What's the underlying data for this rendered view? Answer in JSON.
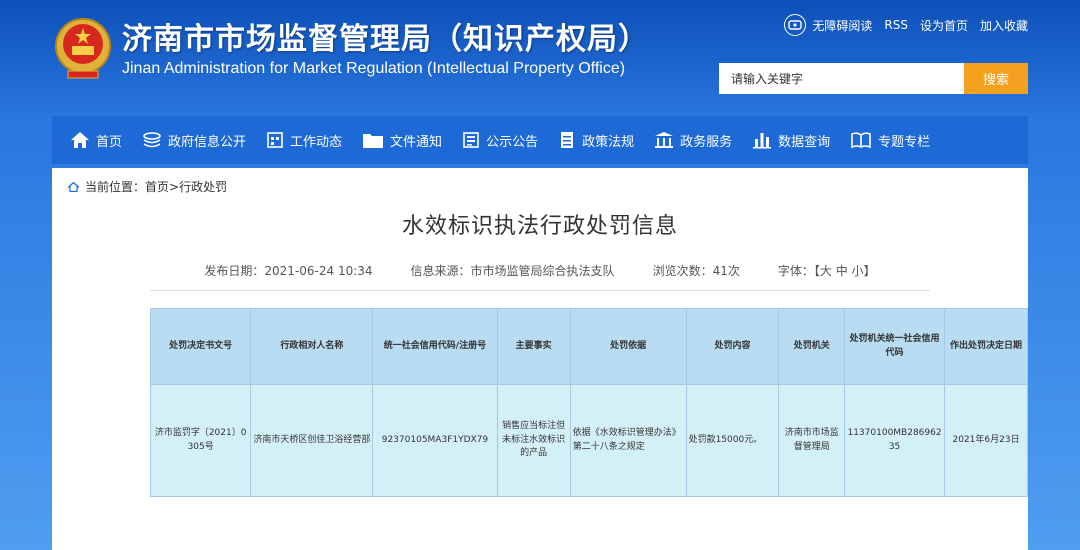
{
  "header": {
    "title_cn": "济南市市场监督管理局（知识产权局）",
    "title_en": "Jinan Administration for Market Regulation (Intellectual Property Office)",
    "links": [
      "无障碍阅读",
      "RSS",
      "设为首页",
      "加入收藏"
    ],
    "search_placeholder": "请输入关键字",
    "search_button": "搜索"
  },
  "nav": {
    "items": [
      {
        "label": "首页",
        "icon": "home-icon"
      },
      {
        "label": "政府信息公开",
        "icon": "stack-icon"
      },
      {
        "label": "工作动态",
        "icon": "calendar-icon"
      },
      {
        "label": "文件通知",
        "icon": "folder-icon"
      },
      {
        "label": "公示公告",
        "icon": "notice-icon"
      },
      {
        "label": "政策法规",
        "icon": "document-icon"
      },
      {
        "label": "政务服务",
        "icon": "building-icon"
      },
      {
        "label": "数据查询",
        "icon": "bar-chart-icon"
      },
      {
        "label": "专题专栏",
        "icon": "book-icon"
      }
    ]
  },
  "breadcrumb": {
    "prefix": "当前位置：",
    "path": "首页>行政处罚"
  },
  "article": {
    "title": "水效标识执法行政处罚信息",
    "date": "发布日期：2021-06-24 10:34",
    "source": "信息来源：市市场监管局综合执法支队",
    "views": "浏览次数：41次",
    "font_label": "字体：【",
    "font_large": "大",
    "font_medium": "中",
    "font_small": "小",
    "font_end": "】"
  },
  "table": {
    "headers": [
      "处罚决定书文号",
      "行政相对人名称",
      "统一社会信用代码/注册号",
      "主要事实",
      "处罚依据",
      "处罚内容",
      "处罚机关",
      "处罚机关统一社会信用代码",
      "作出处罚决定日期"
    ],
    "rows": [
      [
        "济市监罚字〔2021〕0305号",
        "济南市天桥区创佳卫浴经营部",
        "92370105MA3F1YDX79",
        "销售应当标注但未标注水效标识的产品",
        "依据《水效标识管理办法》第二十八条之规定",
        "处罚款15000元。",
        "济南市市场监督管理局",
        "11370100MB28696235",
        "2021年6月23日"
      ]
    ]
  },
  "colors": {
    "nav_bg": "#1d6ad6",
    "search_btn": "#f5a01f",
    "table_header": "#b9dcf2",
    "table_cell": "#d4f0f7"
  }
}
